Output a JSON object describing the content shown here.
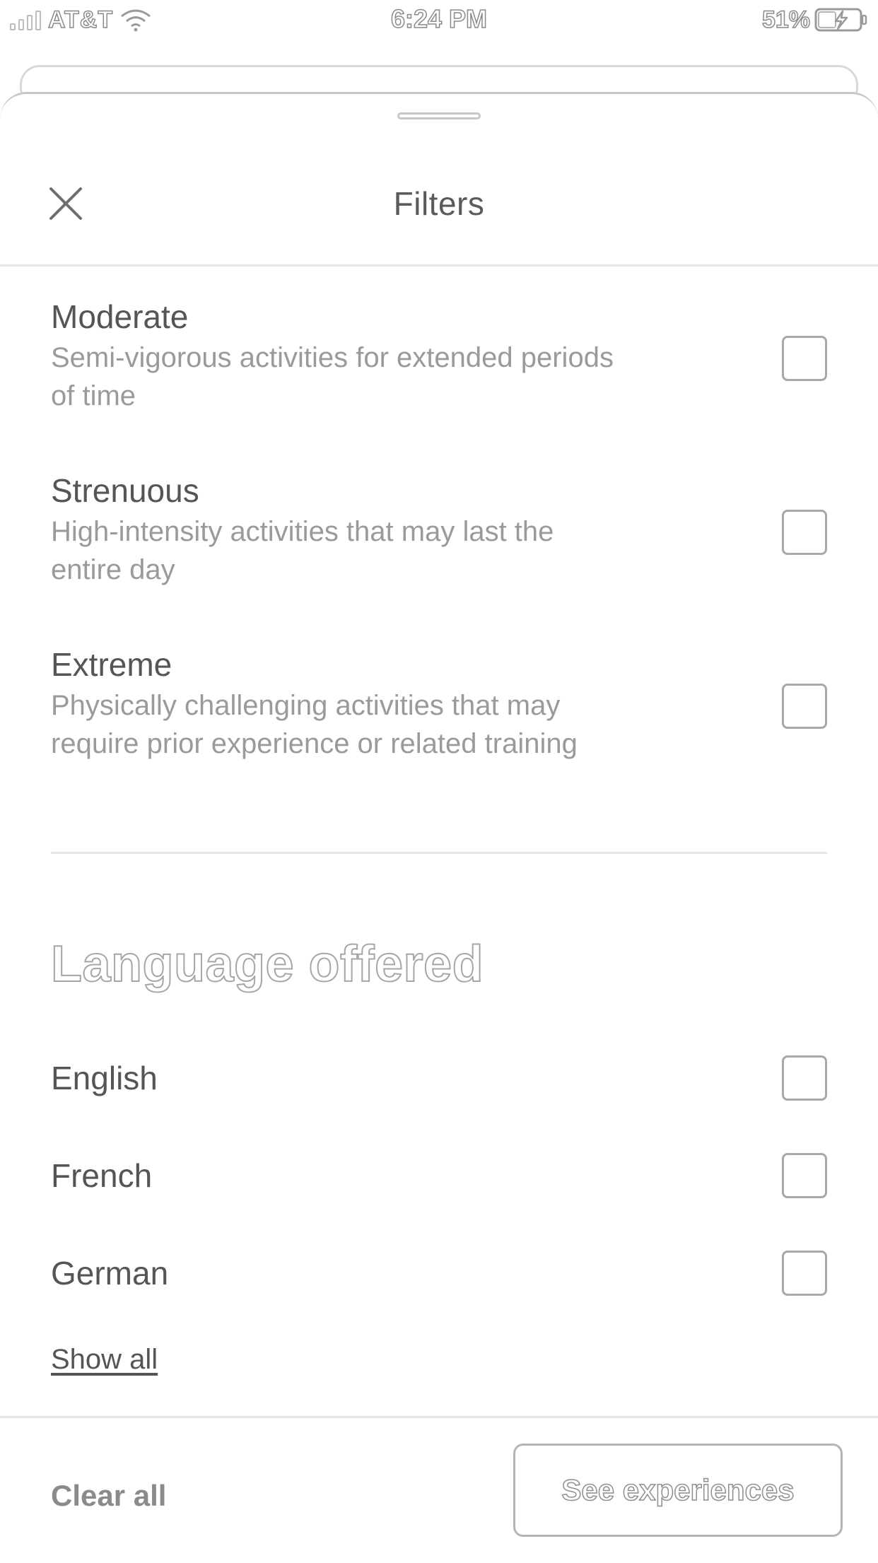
{
  "status_bar": {
    "carrier": "AT&T",
    "time": "6:24 PM",
    "battery": "51%"
  },
  "header": {
    "title": "Filters",
    "close_icon": "close-icon"
  },
  "activity_levels": [
    {
      "title": "Moderate",
      "description": "Semi-vigorous activities for extended periods of time",
      "checked": false
    },
    {
      "title": "Strenuous",
      "description": "High-intensity activities that may last the entire day",
      "checked": false
    },
    {
      "title": "Extreme",
      "description": "Physically challenging activities that may require prior experience or related training",
      "checked": false
    }
  ],
  "language": {
    "heading": "Language offered",
    "options": [
      {
        "label": "English",
        "checked": false
      },
      {
        "label": "French",
        "checked": false
      },
      {
        "label": "German",
        "checked": false
      }
    ],
    "show_all": "Show all"
  },
  "footer": {
    "clear_all": "Clear all",
    "primary_button": "See experiences"
  }
}
